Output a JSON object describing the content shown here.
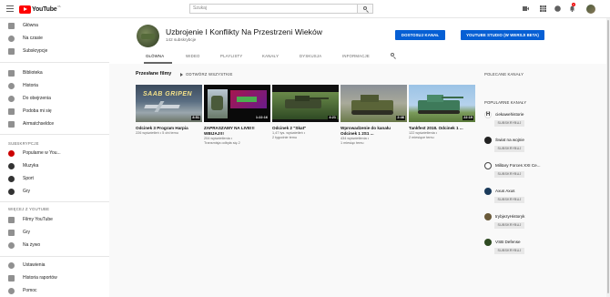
{
  "topbar": {
    "logo_text": "YouTube",
    "logo_sup": "PL",
    "search_placeholder": "Szukaj",
    "notification_count": "3"
  },
  "sidebar": {
    "items_top": [
      {
        "label": "Główna",
        "icon": "home-icon",
        "active": false
      },
      {
        "label": "Na czasie",
        "icon": "flame-icon",
        "active": false
      },
      {
        "label": "Subskrypcje",
        "icon": "subscriptions-icon",
        "active": false
      }
    ],
    "items_lib": [
      {
        "label": "Biblioteka",
        "icon": "library-icon"
      },
      {
        "label": "Historia",
        "icon": "history-icon"
      },
      {
        "label": "Do obejrzenia",
        "icon": "clock-icon"
      },
      {
        "label": "Podoba mi się",
        "icon": "thumbs-up-icon"
      },
      {
        "label": "Airmatchseldce",
        "icon": "playlist-icon"
      }
    ],
    "subs_heading": "SUBSKRYPCJE",
    "subs": [
      {
        "label": "Popularne w You...",
        "icon": "popular-icon"
      },
      {
        "label": "Muzyka",
        "icon": "music-icon"
      },
      {
        "label": "Sport",
        "icon": "sport-icon"
      },
      {
        "label": "Gry",
        "icon": "gaming-icon"
      }
    ],
    "more_heading": "WIĘCEJ Z YOUTUBE",
    "more": [
      {
        "label": "Filmy YouTube",
        "icon": "movies-icon"
      },
      {
        "label": "Gry",
        "icon": "gaming-icon"
      },
      {
        "label": "Na żywo",
        "icon": "live-icon"
      }
    ],
    "bottom": [
      {
        "label": "Ustawienia",
        "icon": "gear-icon"
      },
      {
        "label": "Historia raportów",
        "icon": "flag-icon"
      },
      {
        "label": "Pomoc",
        "icon": "help-icon"
      }
    ]
  },
  "channel": {
    "title": "Uzbrojenie I Konflikty Na Przestrzeni Wieków",
    "subscribers": "142 subskrybcje",
    "customize_label": "DOSTOSUJ KANAŁ",
    "studio_label": "YOUTUBE STUDIO (W WERSJI BETA)",
    "tabs": [
      "GŁÓWNA",
      "WIDEO",
      "PLAYLISTY",
      "KANAŁY",
      "DYSKUSJA",
      "INFORMACJE"
    ]
  },
  "uploads": {
    "title": "Przesłane filmy",
    "play_all": "ODTWÓRZ WSZYSTKIE",
    "videos": [
      {
        "title": "Odcinek 3 Program Harpia",
        "duration": "8:51",
        "meta1": "226 wyświetleń • 5 dni temu",
        "meta2": "",
        "thumb_text": "SAAB GRIPEN"
      },
      {
        "title": "ZAPRASZAMY NA LIVE!!! WBIJAJ!!!",
        "duration": "1:22:16",
        "meta1": "204 wyświetlenia •",
        "meta2": "Transmisja odbyła się 2",
        "thumb_text": ""
      },
      {
        "title": "Odcinek 2 \"Skat\"",
        "duration": "4:21",
        "meta1": "1,47 tys. wyświetleń •",
        "meta2": "2 tygodnie temu",
        "thumb_text": ""
      },
      {
        "title": "Wprowadzenie do kanału Odcinek 1 2S1 ...",
        "duration": "2:46",
        "meta1": "434 wyświetlenia •",
        "meta2": "1 miesiąc temu",
        "thumb_text": ""
      },
      {
        "title": "Tankfest 2018. Odcinek 1 ...",
        "duration": "22:19",
        "meta1": "122 wyświetlenia •",
        "meta2": "2 miesiące temu",
        "thumb_text": ""
      }
    ]
  },
  "right": {
    "featured_heading": "POLECANE KANAŁY",
    "popular_heading": "POPULARNE KANAŁY",
    "subscribe_label": "SUBSKRYBUJ",
    "channels": [
      {
        "name": "ciekawehistorie"
      },
      {
        "name": "Świat na wojnie"
      },
      {
        "name": "Military Forces XXI Ce..."
      },
      {
        "name": "Axus Axus"
      },
      {
        "name": "trybjezyHistoryk"
      },
      {
        "name": "VSB Defense"
      }
    ]
  },
  "colors": {
    "accent": "#065fd4",
    "brand": "#ff0000"
  }
}
